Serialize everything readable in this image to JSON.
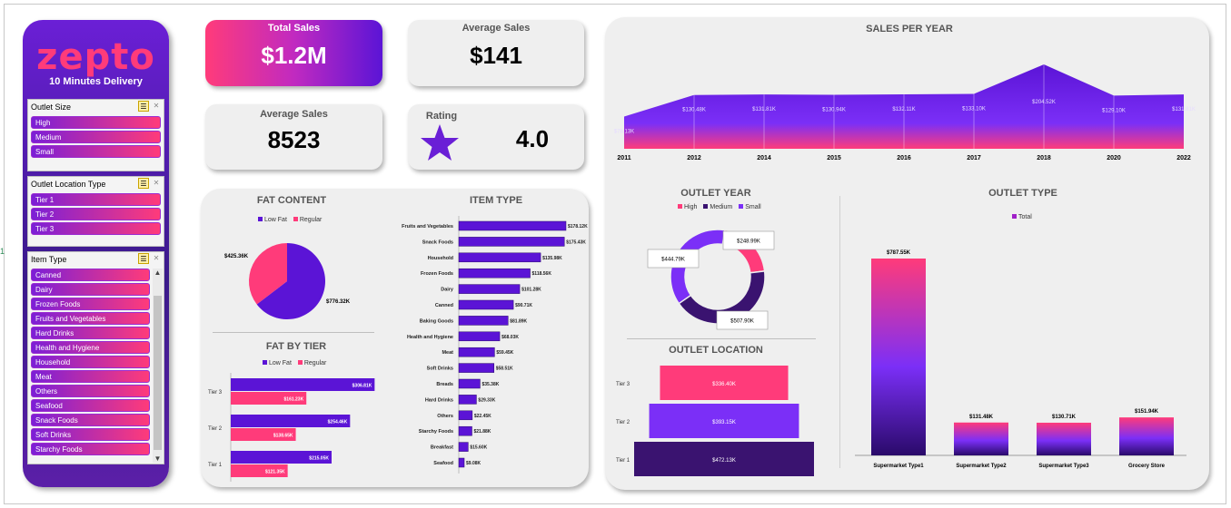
{
  "brand": {
    "logo": "zepto",
    "tagline": "10 Minutes Delivery"
  },
  "slicers": [
    {
      "title": "Outlet Size",
      "items": [
        "High",
        "Medium",
        "Small"
      ]
    },
    {
      "title": "Outlet Location Type",
      "items": [
        "Tier 1",
        "Tier 2",
        "Tier 3"
      ]
    },
    {
      "title": "Item Type",
      "items": [
        "Canned",
        "Dairy",
        "Frozen Foods",
        "Fruits and Vegetables",
        "Hard Drinks",
        "Health and Hygiene",
        "Household",
        "Meat",
        "Others",
        "Seafood",
        "Snack Foods",
        "Soft Drinks",
        "Starchy Foods"
      ]
    }
  ],
  "kpis": {
    "total_sales": {
      "label": "Total Sales",
      "value": "$1.2M"
    },
    "average_sales": {
      "label": "Average Sales",
      "value": "$141"
    },
    "item_count": {
      "label": "Average Sales",
      "value": "8523"
    },
    "rating": {
      "label": "Rating",
      "value": "4.0"
    }
  },
  "colors": {
    "purple": "#5b14d6",
    "pink": "#ff3b7a",
    "dark": "#3a1370",
    "violet": "#7b2ff7"
  },
  "chart_data": [
    {
      "id": "sales_per_year",
      "type": "area",
      "title": "SALES PER YEAR",
      "x": [
        "2011",
        "2012",
        "2014",
        "2015",
        "2016",
        "2017",
        "2018",
        "2020",
        "2022"
      ],
      "values": [
        78.13,
        130.48,
        131.81,
        130.94,
        132.11,
        133.1,
        204.52,
        129.1,
        131.8
      ],
      "labels": [
        "$78.13K",
        "$130.48K",
        "$131.81K",
        "$130.94K",
        "$132.11K",
        "$133.10K",
        "$204.52K",
        "$129.10K",
        "$131.81K"
      ],
      "ylim": [
        0,
        220
      ]
    },
    {
      "id": "fat_content",
      "type": "pie",
      "title": "FAT CONTENT",
      "categories": [
        "Low Fat",
        "Regular"
      ],
      "values": [
        776.32,
        425.36
      ],
      "labels": [
        "$776.32K",
        "$425.36K"
      ]
    },
    {
      "id": "fat_by_tier",
      "type": "bar",
      "title": "FAT BY TIER",
      "categories": [
        "Tier 3",
        "Tier 2",
        "Tier 1"
      ],
      "series": [
        {
          "name": "Low Fat",
          "values": [
            306.81,
            254.46,
            215.05
          ],
          "labels": [
            "$306.81K",
            "$254.46K",
            "$215.05K"
          ]
        },
        {
          "name": "Regular",
          "values": [
            161.23,
            138.65,
            121.35
          ],
          "labels": [
            "$161.23K",
            "$138.65K",
            "$121.35K"
          ]
        }
      ]
    },
    {
      "id": "item_type",
      "type": "bar",
      "title": "ITEM TYPE",
      "categories": [
        "Fruits and Vegetables",
        "Snack Foods",
        "Household",
        "Frozen Foods",
        "Dairy",
        "Canned",
        "Baking Goods",
        "Health and Hygiene",
        "Meat",
        "Soft Drinks",
        "Breads",
        "Hard Drinks",
        "Others",
        "Starchy Foods",
        "Breakfast",
        "Seafood"
      ],
      "values": [
        178.12,
        175.43,
        135.98,
        118.56,
        101.28,
        90.71,
        81.89,
        68.03,
        59.45,
        58.51,
        35.38,
        29.33,
        22.45,
        21.88,
        15.6,
        9.08
      ],
      "labels": [
        "$178.12K",
        "$175.43K",
        "$135.98K",
        "$118.56K",
        "$101.28K",
        "$90.71K",
        "$81.89K",
        "$68.03K",
        "$59.45K",
        "$58.51K",
        "$35.38K",
        "$29.33K",
        "$22.45K",
        "$21.88K",
        "$15.60K",
        "$9.08K"
      ]
    },
    {
      "id": "outlet_year",
      "type": "pie",
      "title": "OUTLET YEAR",
      "categories": [
        "High",
        "Medium",
        "Small"
      ],
      "values": [
        248.99,
        507.9,
        444.79
      ],
      "labels": [
        "$248.99K",
        "$507.90K",
        "$444.79K"
      ]
    },
    {
      "id": "outlet_location",
      "type": "bar",
      "title": "OUTLET LOCATION",
      "categories": [
        "Tier 3",
        "Tier 2",
        "Tier 1"
      ],
      "values": [
        336.4,
        393.15,
        472.13
      ],
      "labels": [
        "$336.40K",
        "$393.15K",
        "$472.13K"
      ]
    },
    {
      "id": "outlet_type",
      "type": "bar",
      "title": "OUTLET TYPE",
      "legend": "Total",
      "categories": [
        "Supermarket Type1",
        "Supermarket Type2",
        "Supermarket Type3",
        "Grocery Store"
      ],
      "values": [
        787.55,
        131.48,
        130.71,
        151.94
      ],
      "labels": [
        "$787.55K",
        "$131.48K",
        "$130.71K",
        "$151.94K"
      ]
    }
  ]
}
